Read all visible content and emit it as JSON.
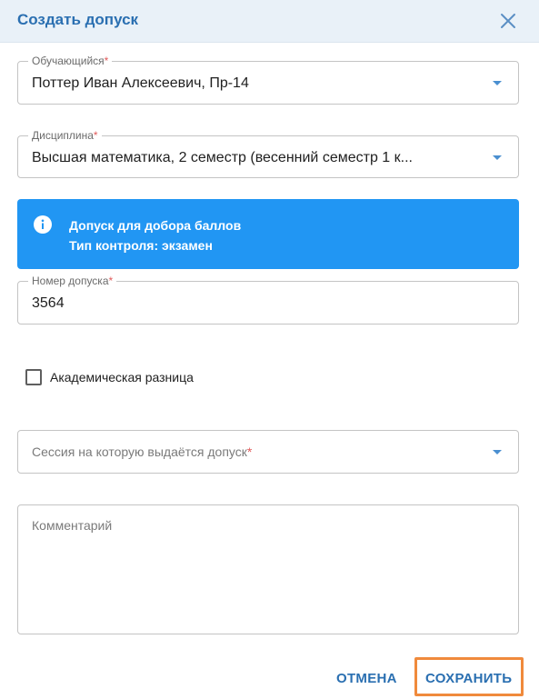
{
  "dialog": {
    "title": "Создать допуск"
  },
  "fields": {
    "student": {
      "label": "Обучающийся",
      "required": "*",
      "value": "Поттер Иван Алексеевич, Пр-14"
    },
    "discipline": {
      "label": "Дисциплина",
      "required": "*",
      "value": "Высшая математика, 2 семестр (весенний семестр 1 к..."
    },
    "admission_number": {
      "label": "Номер допуска",
      "required": "*",
      "value": "3564"
    },
    "session": {
      "placeholder": "Сессия на которую выдаётся допуск",
      "required": "*"
    },
    "comment": {
      "placeholder": "Комментарий"
    }
  },
  "info_banner": {
    "line1": "Допуск для добора баллов",
    "line2_label": "Тип контроля:",
    "line2_value": "экзамен"
  },
  "academic_difference": {
    "label": "Академическая разница",
    "checked": false
  },
  "actions": {
    "cancel_label": "ОТМЕНА",
    "save_label": "СОХРАНИТЬ"
  },
  "colors": {
    "accent": "#2a6fb1",
    "info_bg": "#2196f3",
    "highlight": "#f08a3c",
    "required": "#e15b5b"
  },
  "icons": {
    "close": "close-icon",
    "dropdown": "chevron-down-icon",
    "info": "info-icon"
  }
}
